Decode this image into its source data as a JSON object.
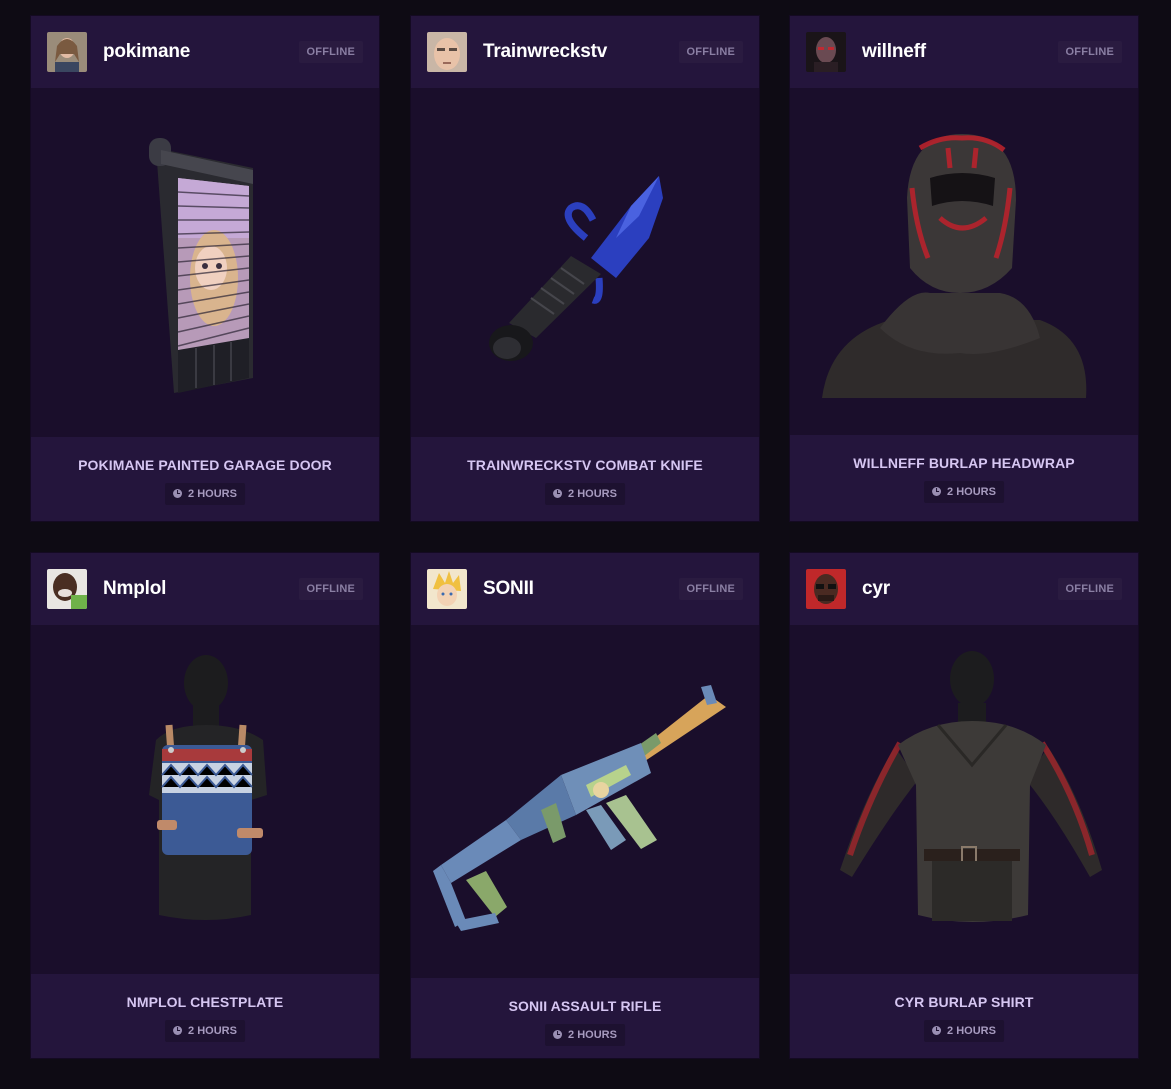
{
  "cards": [
    {
      "username": "pokimane",
      "status": "OFFLINE",
      "item_name": "POKIMANE PAINTED GARAGE DOOR",
      "duration": "2 HOURS",
      "image_icon": "garage-door-icon"
    },
    {
      "username": "Trainwreckstv",
      "status": "OFFLINE",
      "item_name": "TRAINWRECKSTV COMBAT KNIFE",
      "duration": "2 HOURS",
      "image_icon": "combat-knife-icon"
    },
    {
      "username": "willneff",
      "status": "OFFLINE",
      "item_name": "WILLNEFF BURLAP HEADWRAP",
      "duration": "2 HOURS",
      "image_icon": "headwrap-icon"
    },
    {
      "username": "Nmplol",
      "status": "OFFLINE",
      "item_name": "NMPLOL CHESTPLATE",
      "duration": "2 HOURS",
      "image_icon": "chestplate-icon"
    },
    {
      "username": "SONII",
      "status": "OFFLINE",
      "item_name": "SONII ASSAULT RIFLE",
      "duration": "2 HOURS",
      "image_icon": "assault-rifle-icon"
    },
    {
      "username": "cyr",
      "status": "OFFLINE",
      "item_name": "CYR BURLAP SHIRT",
      "duration": "2 HOURS",
      "image_icon": "burlap-shirt-icon"
    }
  ],
  "colors": {
    "page_bg": "#0e0b14",
    "card_bg": "#1a0e2b",
    "header_bg": "#24153c",
    "item_name": "#d6c6f2",
    "status_text": "#8a7fa3"
  }
}
